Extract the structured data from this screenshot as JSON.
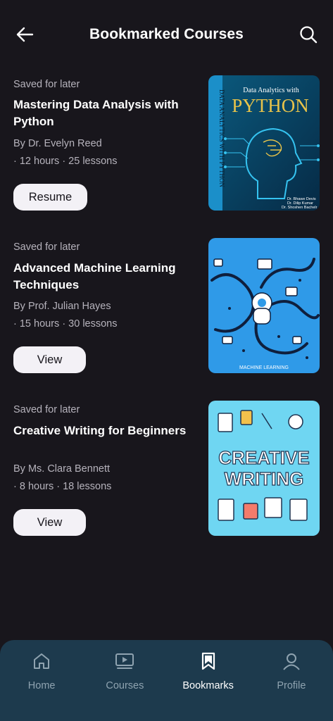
{
  "header": {
    "title": "Bookmarked Courses",
    "back_icon": "arrow-left-icon",
    "search_icon": "search-icon"
  },
  "courses": [
    {
      "status": "Saved for later",
      "title": "Mastering Data Analysis with Python",
      "author": "By Dr. Evelyn Reed",
      "meta": "· 12 hours · 25 lessons",
      "button": "Resume",
      "cover": {
        "top_text": "Data Analytics with",
        "big_text": "PYTHON",
        "spine_text": "DATA ANALYTICS WITH PYTHON",
        "authors": [
          "Dr. Bhawe Devis",
          "Dr. Dilip Kumar",
          "Dr. Shoshen Bachelr",
          "Mr. Pintu Vora"
        ]
      }
    },
    {
      "status": "Saved for later",
      "title": "Advanced Machine Learning Techniques",
      "author": "By Prof. Julian Hayes",
      "meta": "· 15 hours · 30 lessons",
      "button": "View",
      "cover": {
        "caption": "MACHINE LEARNING"
      }
    },
    {
      "status": "Saved for later",
      "title": "Creative Writing for Beginners",
      "author": "By Ms. Clara Bennett",
      "meta": "· 8 hours · 18 lessons",
      "button": "View",
      "cover": {
        "line1": "CREATIVE",
        "line2": "WRITING"
      }
    }
  ],
  "nav": {
    "items": [
      {
        "label": "Home",
        "icon": "home-icon"
      },
      {
        "label": "Courses",
        "icon": "play-screen-icon"
      },
      {
        "label": "Bookmarks",
        "icon": "bookmark-icon",
        "active": true
      },
      {
        "label": "Profile",
        "icon": "user-icon"
      }
    ]
  },
  "colors": {
    "background": "#18161c",
    "nav_background": "#1d3a4d",
    "button_background": "#f3f1f6",
    "muted_text": "#b6b3bc"
  }
}
